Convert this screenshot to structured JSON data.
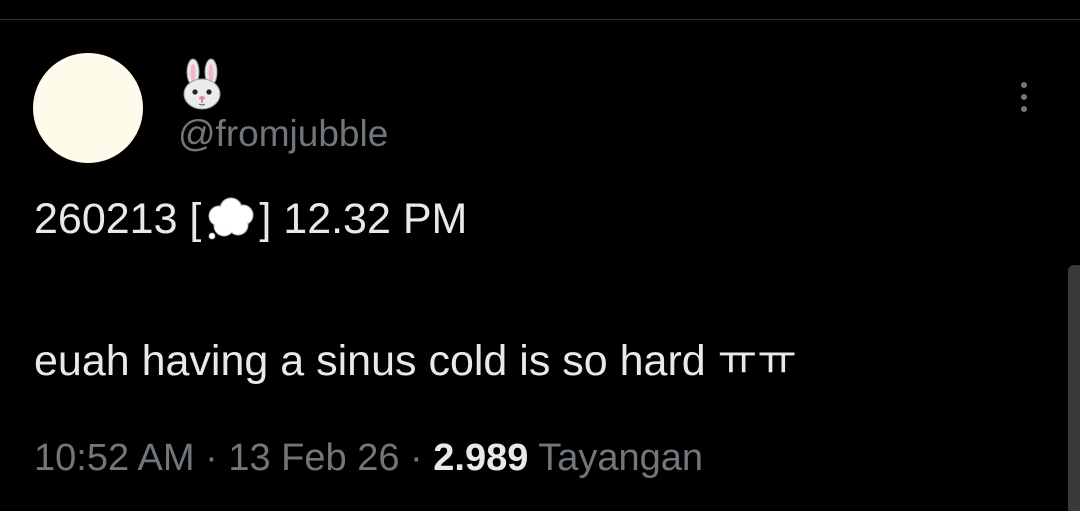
{
  "user": {
    "display_name_icon": "rabbit-face-icon",
    "handle": "@fromjubble",
    "avatar_color": "#fffbea"
  },
  "tweet": {
    "line1_prefix": "260213 [",
    "line1_icon": "thought-balloon-icon",
    "line1_suffix": "] 12.32 PM",
    "line2": "euah having a sinus cold is so hard ㅠㅠ"
  },
  "meta": {
    "time": "10:52 AM",
    "sep1": " · ",
    "date": "13 Feb 26",
    "sep2": " · ",
    "views_count": "2.989",
    "views_label": " Tayangan"
  },
  "icons": {
    "more": "more-vertical-icon"
  },
  "colors": {
    "background": "#000000",
    "text_primary": "#e7e9ea",
    "text_secondary": "#71767b"
  }
}
